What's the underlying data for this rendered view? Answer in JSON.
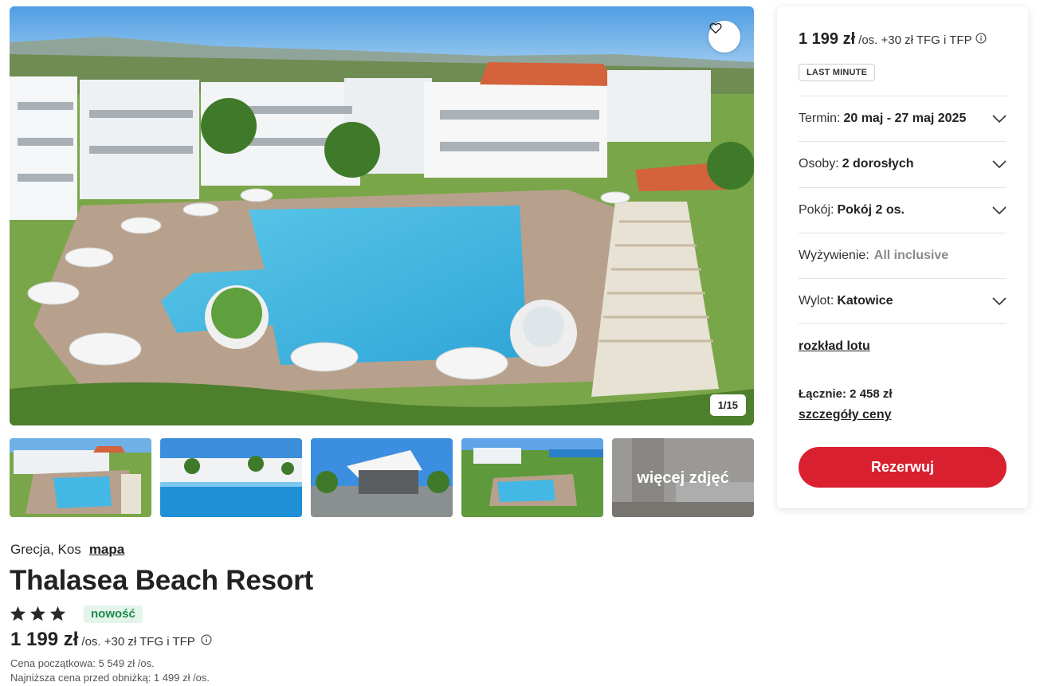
{
  "gallery": {
    "counter": "1/15",
    "more_label": "więcej zdjęć"
  },
  "hotel": {
    "location": "Grecja, Kos",
    "map_link": "mapa",
    "name": "Thalasea Beach Resort",
    "stars": 3,
    "badge": "nowość",
    "price": "1 199 zł",
    "price_suffix": "/os. +30 zł TFG i TFP",
    "initial_price": "Cena początkowa: 5 549 zł /os.",
    "lowest_price": "Najniższa cena przed obniżką: 1 499 zł /os."
  },
  "booking": {
    "price": "1 199 zł",
    "price_suffix": "/os. +30 zł TFG i TFP",
    "badge": "LAST MINUTE",
    "term_label": "Termin:",
    "term_value": "20 maj - 27 maj 2025",
    "persons_label": "Osoby:",
    "persons_value": "2 dorosłych",
    "room_label": "Pokój:",
    "room_value": "Pokój 2 os.",
    "board_label": "Wyżywienie:",
    "board_value": "All inclusive",
    "departure_label": "Wylot:",
    "departure_value": "Katowice",
    "flight_schedule_link": "rozkład lotu",
    "total": "Łącznie: 2 458 zł",
    "price_details_link": "szczegóły ceny",
    "book_button": "Rezerwuj"
  },
  "colors": {
    "brand_red": "#d9202f",
    "badge_green_bg": "#e3f5ea",
    "badge_green_text": "#1d8a4a"
  },
  "icons": [
    "heart-icon",
    "star-icon",
    "info-icon",
    "chevron-down-icon"
  ]
}
